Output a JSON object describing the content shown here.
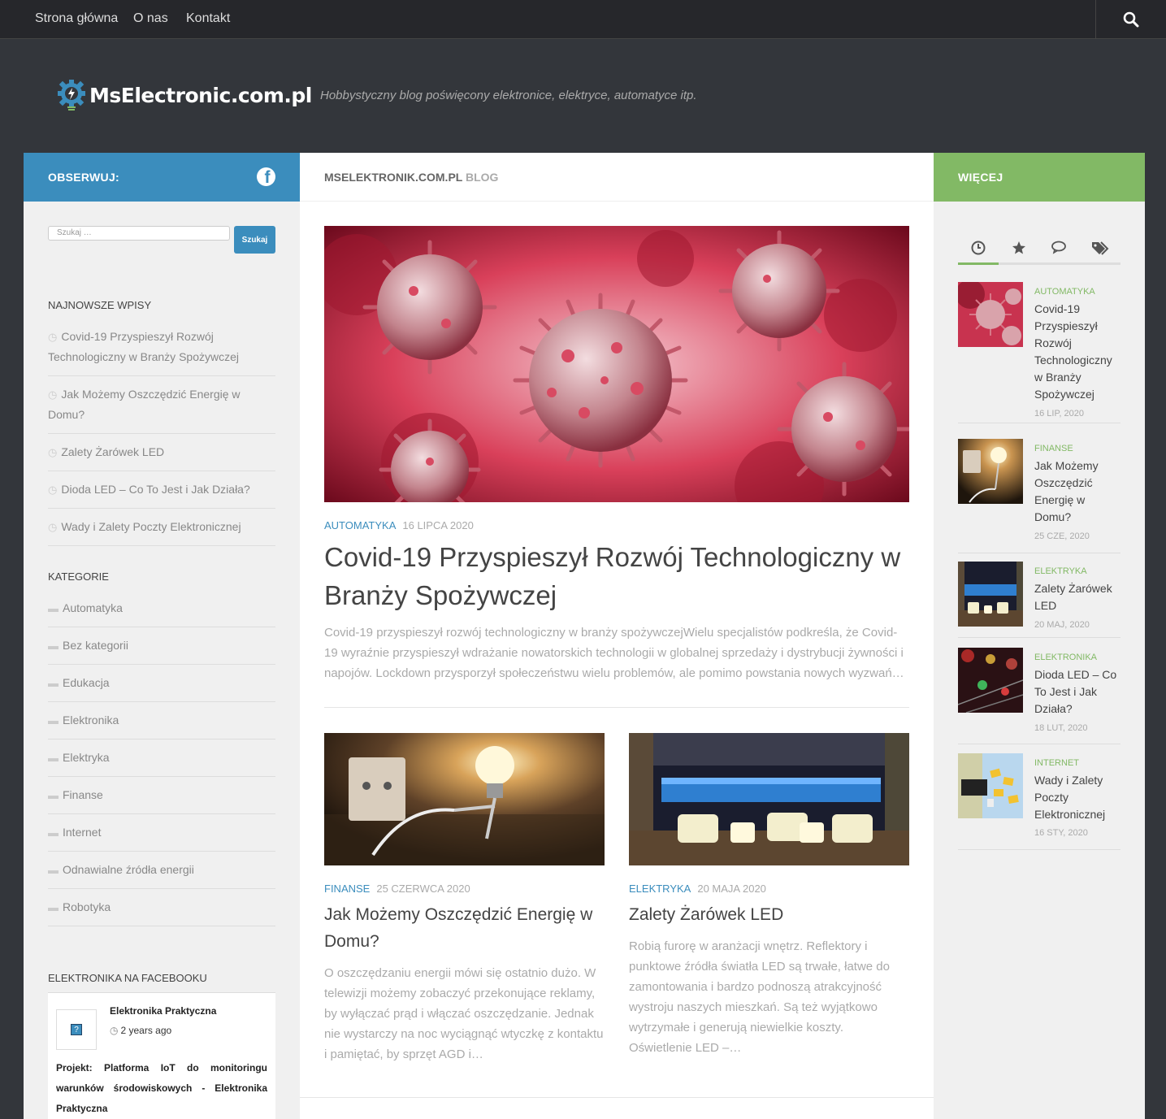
{
  "nav": {
    "items": [
      {
        "label": "Strona główna"
      },
      {
        "label": "O nas"
      },
      {
        "label": "Kontakt"
      }
    ]
  },
  "header": {
    "logo_text": "MsElectronic.com.pl",
    "tagline": "Hobbystyczny blog poświęcony elektronice, elektryce, automatyce itp."
  },
  "left": {
    "follow_label": "OBSERWUJ:",
    "search_placeholder": "Szukaj …",
    "search_button": "Szukaj",
    "recent_title": "NAJNOWSZE WPISY",
    "recent": [
      "Covid-19 Przyspieszył Rozwój Technologiczny w Branży Spożywczej",
      "Jak Możemy Oszczędzić Energię w Domu?",
      "Zalety Żarówek LED",
      "Dioda LED – Co To Jest i Jak Działa?",
      "Wady i Zalety Poczty Elektronicznej"
    ],
    "categories_title": "KATEGORIE",
    "categories": [
      "Automatyka",
      "Bez kategorii",
      "Edukacja",
      "Elektronika",
      "Elektryka",
      "Finanse",
      "Internet",
      "Odnawialne źródła energii",
      "Robotyka"
    ],
    "facebook_title": "ELEKTRONIKA NA FACEBOOKU",
    "facebook": {
      "avatar_glyph": "?",
      "page_name": "Elektronika Praktyczna",
      "time": "2 years ago",
      "post": "Projekt: Platforma IoT do monitoringu warunków środowiskowych - Elektronika Praktyczna"
    }
  },
  "main": {
    "breadcrumb_site": "MSELEKTRONIK.COM.PL",
    "breadcrumb_section": "BLOG",
    "featured": {
      "category": "AUTOMATYKA",
      "date": "16 LIPCA 2020",
      "title": "Covid-19 Przyspieszył Rozwój Technologiczny w Branży Spożywczej",
      "excerpt": "Covid-19 przyspieszył rozwój technologiczny w branży spożywczejWielu specjalistów podkreśla, że Covid-19 wyraźnie przyspieszył wdrażanie nowatorskich technologii w globalnej sprzedaży i dystrybucji żywności i napojów. Lockdown przysporzył społeczeństwu wielu problemów, ale pomimo powstania nowych wyzwań…"
    },
    "posts": [
      {
        "category": "FINANSE",
        "date": "25 CZERWCA 2020",
        "title": "Jak Możemy Oszczędzić Energię w Domu?",
        "excerpt": "O oszczędzaniu energii mówi się ostatnio dużo. W telewizji możemy zobaczyć przekonujące reklamy, by wyłączać prąd i włączać oszczędzanie. Jednak nie wystarczy na noc wyciągnąć wtyczkę z kontaktu i pamiętać, by sprzęt AGD i…"
      },
      {
        "category": "ELEKTRYKA",
        "date": "20 MAJA 2020",
        "title": "Zalety Żarówek LED",
        "excerpt": "Robią furorę w aranżacji wnętrz. Reflektory i punktowe źródła światła LED są trwałe, łatwe do zamontowania i bardzo podnoszą atrakcyjność wystroju naszych mieszkań. Są też wyjątkowo wytrzymałe i generują niewielkie koszty. Oświetlenie LED –…"
      }
    ]
  },
  "right": {
    "more_label": "WIĘCEJ",
    "tabs": [
      "clock-icon",
      "star-icon",
      "comments-icon",
      "tags-icon"
    ],
    "items": [
      {
        "category": "AUTOMATYKA",
        "title": "Covid-19 Przyspieszył Rozwój Technologiczny w Branży Spożywczej",
        "date": "16 LIP, 2020"
      },
      {
        "category": "FINANSE",
        "title": "Jak Możemy Oszczędzić Energię w Domu?",
        "date": "25 CZE, 2020"
      },
      {
        "category": "ELEKTRYKA",
        "title": "Zalety Żarówek LED",
        "date": "20 MAJ, 2020"
      },
      {
        "category": "ELEKTRONIKA",
        "title": "Dioda LED – Co To Jest i Jak Działa?",
        "date": "18 LUT, 2020"
      },
      {
        "category": "INTERNET",
        "title": "Wady i Zalety Poczty Elektronicznej",
        "date": "16 STY, 2020"
      }
    ]
  },
  "colors": {
    "blue": "#3b8dbd",
    "green": "#82b965",
    "dark": "#33363b"
  }
}
